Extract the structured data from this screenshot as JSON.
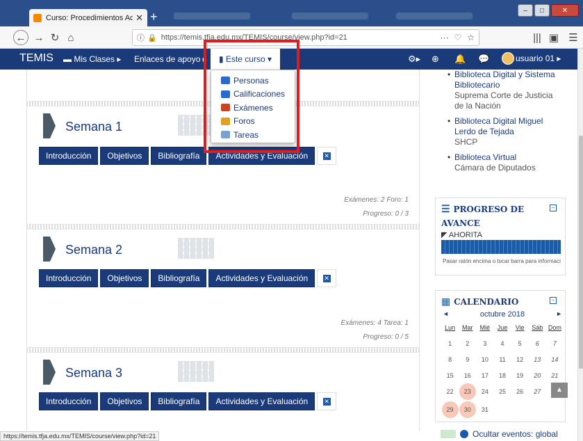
{
  "browser": {
    "tab_title": "Curso: Procedimientos Admin",
    "url": "https://temis.tfja.edu.mx/TEMIS/course/view.php?id=21",
    "url_actions": [
      "···",
      "♡",
      "☆"
    ],
    "status_url": "https://temis.tfja.edu.mx/TEMIS/course/view.php?id=21"
  },
  "header": {
    "brand": "TEMIS",
    "nav": [
      {
        "label": "Mis Clases ▸"
      },
      {
        "label": "Enlaces de apoyo ▸"
      }
    ],
    "active_nav": "Este curso ▾",
    "user": "usuario 01 ▸"
  },
  "dropdown": {
    "items": [
      {
        "label": "Personas",
        "color": "#2a6acb"
      },
      {
        "label": "Calificaciones",
        "color": "#2a6acb"
      },
      {
        "label": "Exámenes",
        "color": "#d04020"
      },
      {
        "label": "Foros",
        "color": "#e0a020"
      },
      {
        "label": "Tareas",
        "color": "#7aa0d0"
      }
    ]
  },
  "weeks": [
    {
      "title": "Semana 1",
      "buttons": [
        "Introducción",
        "Objetivos",
        "Bibliografía",
        "Actividades y Evaluación"
      ],
      "meta_counts": "Exámenes: 2  Foro: 1",
      "progress": "Progreso: 0 / 3"
    },
    {
      "title": "Semana 2",
      "buttons": [
        "Introducción",
        "Objetivos",
        "Bibliografía",
        "Actividades y Evaluación"
      ],
      "meta_counts": "Exámenes: 4  Tarea: 1",
      "progress": "Progreso: 0 / 5"
    },
    {
      "title": "Semana 3",
      "buttons": [
        "Introducción",
        "Objetivos",
        "Bibliografía",
        "Actividades y Evaluación"
      ],
      "meta_counts": "",
      "progress": ""
    }
  ],
  "sidebar": {
    "libraries": [
      {
        "link": "Biblioteca Digital y Sistema Bibliotecario",
        "sub": "Suprema Corte de Justicia de la Nación"
      },
      {
        "link": "Biblioteca Digital Miguel Lerdo de Tejada",
        "sub": "SHCP"
      },
      {
        "link": "Biblioteca Virtual",
        "sub": "Cámara de Diputados"
      }
    ],
    "progress_block": {
      "title_line1": "PROGRESO DE",
      "title_line2": "AVANCE",
      "label": "◤ AHORITA",
      "hint": "Pasar ratón encima o tocar barra para información"
    },
    "calendar": {
      "title": "CALENDARIO",
      "month": "octubre 2018",
      "prev": "◄",
      "next": "►",
      "weekdays": [
        "Lun",
        "Mar",
        "Mié",
        "Jue",
        "Vie",
        "Sáb",
        "Dom"
      ],
      "days": [
        [
          "1",
          "2",
          "3",
          "4",
          "5",
          "6",
          "7"
        ],
        [
          "8",
          "9",
          "10",
          "11",
          "12",
          "13",
          "14"
        ],
        [
          "15",
          "16",
          "17",
          "18",
          "19",
          "20",
          "21"
        ],
        [
          "22",
          "23",
          "24",
          "25",
          "26",
          "27",
          "28"
        ],
        [
          "29",
          "30",
          "31",
          "",
          "",
          "",
          ""
        ]
      ],
      "event_days": [
        "23",
        "29",
        "30"
      ]
    },
    "hide_events": "Ocultar eventos: global"
  },
  "colors": {
    "header_bg": "#1a3a7a",
    "highlight": "#e01c1c",
    "event_day": "#f8c8b8"
  }
}
